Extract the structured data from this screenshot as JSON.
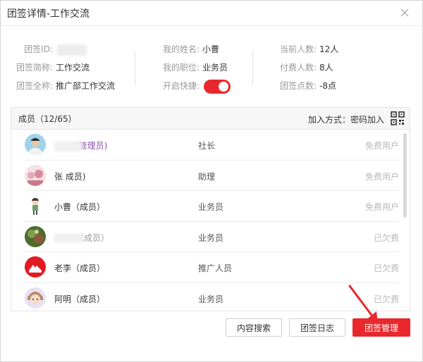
{
  "window": {
    "title": "团签详情-工作交流"
  },
  "info": {
    "col1": [
      {
        "label": "团签ID:",
        "value": ""
      },
      {
        "label": "团签简称:",
        "value": "工作交流"
      },
      {
        "label": "团签全称:",
        "value": "推广部工作交流"
      }
    ],
    "col2": [
      {
        "label": "我的姓名:",
        "value": "小曹"
      },
      {
        "label": "我的职位:",
        "value": "业务员"
      },
      {
        "label": "开启快捷:",
        "value": ""
      }
    ],
    "col3": [
      {
        "label": "当前人数:",
        "value": "12人"
      },
      {
        "label": "付费人数:",
        "value": "8人"
      },
      {
        "label": "团签点数:",
        "value": "-8点"
      }
    ]
  },
  "members": {
    "count_label": "成员（12/65）",
    "join_label": "加入方式：密码加入",
    "rows": [
      {
        "name": "(管理员)",
        "role": "社长",
        "plan": "免费用户",
        "avatar": "person"
      },
      {
        "name": "张 成员)",
        "role": "助理",
        "plan": "免费用户",
        "avatar": "pink"
      },
      {
        "name": "小曹（成员）",
        "role": "业务员",
        "plan": "免费用户",
        "avatar": "cartoon"
      },
      {
        "name": "（成员）",
        "role": "业务员",
        "plan": "已欠费",
        "avatar": "green"
      },
      {
        "name": "老李（成员）",
        "role": "推广人员",
        "plan": "已欠费",
        "avatar": "red"
      },
      {
        "name": "阿明（成员）",
        "role": "业务员",
        "plan": "已欠费",
        "avatar": "anime"
      }
    ]
  },
  "footer": {
    "search_label": "内容搜索",
    "log_label": "团签日志",
    "manage_label": "团签管理"
  },
  "colors": {
    "accent": "#e8282c",
    "admin": "#8e4fb3"
  }
}
